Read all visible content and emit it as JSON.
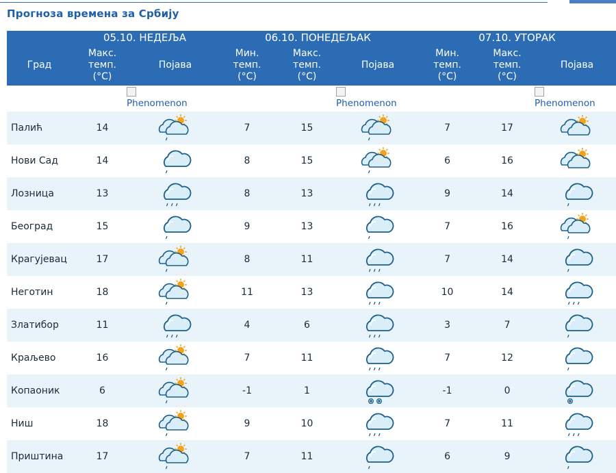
{
  "page_title": "Прогноза времена за Србију",
  "days": [
    "05.10. НЕДЕЉА",
    "06.10. ПОНЕДЕЉАК",
    "07.10. УТОРАК"
  ],
  "columns": {
    "city": "Град",
    "max": "Макс.\nтемп.\n(°C)",
    "min": "Мин.\nтемп.\n(°C)",
    "phen": "Појава"
  },
  "broken_image_alt": "Phenomenon",
  "icon_legend": {
    "partly-cloudy-sun": "cloud with sun",
    "partly-cloudy-sun-drizzle": "clouds with sun and drizzle",
    "cloudy-drizzle": "cloud with drizzle",
    "cloudy-rain": "cloud with rain",
    "snow": "cloud with snowflakes",
    "drizzle-snow": "cloud with snowflake"
  },
  "rows": [
    {
      "city": "Палић",
      "d1_max": "14",
      "d1_icon": "partly-cloudy-sun-drizzle",
      "d2_min": "7",
      "d2_max": "15",
      "d2_icon": "partly-cloudy-sun-drizzle",
      "d3_min": "7",
      "d3_max": "17",
      "d3_icon": "partly-cloudy-sun"
    },
    {
      "city": "Нови Сад",
      "d1_max": "14",
      "d1_icon": "cloudy-drizzle",
      "d2_min": "8",
      "d2_max": "15",
      "d2_icon": "partly-cloudy-sun-drizzle",
      "d3_min": "6",
      "d3_max": "16",
      "d3_icon": "partly-cloudy-sun"
    },
    {
      "city": "Лозница",
      "d1_max": "13",
      "d1_icon": "cloudy-rain",
      "d2_min": "8",
      "d2_max": "13",
      "d2_icon": "cloudy-rain",
      "d3_min": "9",
      "d3_max": "14",
      "d3_icon": "cloudy-drizzle"
    },
    {
      "city": "Београд",
      "d1_max": "15",
      "d1_icon": "cloudy-drizzle",
      "d2_min": "9",
      "d2_max": "13",
      "d2_icon": "cloudy-drizzle",
      "d3_min": "7",
      "d3_max": "16",
      "d3_icon": "partly-cloudy-sun-drizzle"
    },
    {
      "city": "Крагујевац",
      "d1_max": "17",
      "d1_icon": "partly-cloudy-sun-drizzle",
      "d2_min": "8",
      "d2_max": "11",
      "d2_icon": "cloudy-rain",
      "d3_min": "7",
      "d3_max": "14",
      "d3_icon": "cloudy-drizzle"
    },
    {
      "city": "Неготин",
      "d1_max": "18",
      "d1_icon": "partly-cloudy-sun-drizzle",
      "d2_min": "11",
      "d2_max": "13",
      "d2_icon": "cloudy-rain",
      "d3_min": "10",
      "d3_max": "14",
      "d3_icon": "cloudy-rain"
    },
    {
      "city": "Златибор",
      "d1_max": "11",
      "d1_icon": "cloudy-rain",
      "d2_min": "4",
      "d2_max": "6",
      "d2_icon": "cloudy-rain",
      "d3_min": "3",
      "d3_max": "7",
      "d3_icon": "cloudy-drizzle"
    },
    {
      "city": "Краљево",
      "d1_max": "16",
      "d1_icon": "partly-cloudy-sun-drizzle",
      "d2_min": "7",
      "d2_max": "11",
      "d2_icon": "cloudy-rain",
      "d3_min": "7",
      "d3_max": "12",
      "d3_icon": "cloudy-drizzle"
    },
    {
      "city": "Копаоник",
      "d1_max": "6",
      "d1_icon": "partly-cloudy-sun-drizzle",
      "d2_min": "-1",
      "d2_max": "1",
      "d2_icon": "snow",
      "d3_min": "-1",
      "d3_max": "0",
      "d3_icon": "drizzle-snow"
    },
    {
      "city": "Ниш",
      "d1_max": "18",
      "d1_icon": "partly-cloudy-sun-drizzle",
      "d2_min": "9",
      "d2_max": "10",
      "d2_icon": "cloudy-rain",
      "d3_min": "7",
      "d3_max": "11",
      "d3_icon": "cloudy-rain"
    },
    {
      "city": "Приштина",
      "d1_max": "17",
      "d1_icon": "partly-cloudy-sun-drizzle",
      "d2_min": "7",
      "d2_max": "11",
      "d2_icon": "cloudy-drizzle",
      "d3_min": "6",
      "d3_max": "9",
      "d3_icon": "cloudy-drizzle"
    }
  ],
  "colors": {
    "header_bg": "#2b6cb4",
    "title": "#1f5fa8",
    "stripe": "#e9f4fa",
    "sun": "#f3a21a",
    "cloud_fill": "#d9eef8",
    "cloud_stroke": "#1d5f86"
  }
}
